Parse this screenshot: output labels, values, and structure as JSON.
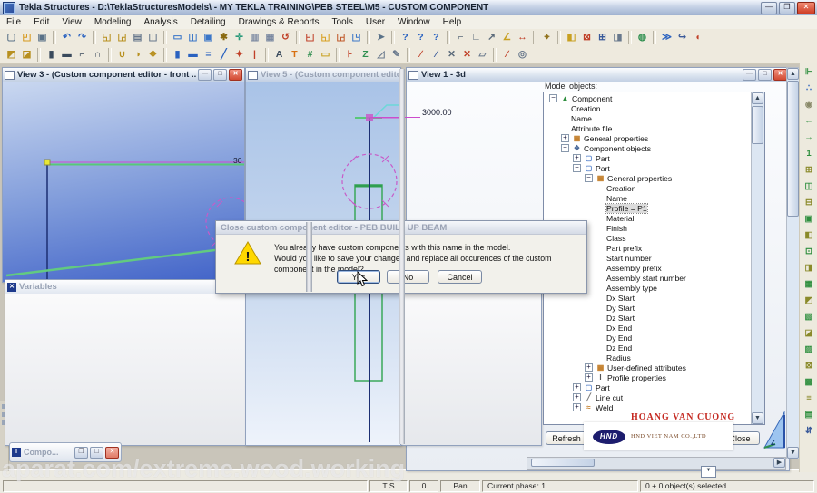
{
  "window": {
    "title": "Tekla Structures - D:\\TeklaStructuresModels\\ - MY TEKLA TRAINING\\PEB STEEL\\M5 - CUSTOM COMPONENT"
  },
  "menu": {
    "items": [
      "File",
      "Edit",
      "View",
      "Modeling",
      "Analysis",
      "Detailing",
      "Drawings & Reports",
      "Tools",
      "User",
      "Window",
      "Help"
    ]
  },
  "toolbar1": {
    "groups": [
      [
        "new",
        "open",
        "save"
      ],
      [
        "undo",
        "redo"
      ],
      [
        "fetch",
        "publish",
        "print",
        "catalog"
      ],
      [
        "fit-work-area",
        "fit-by-parts",
        "zoom-original",
        "zoom-in",
        "pan-view",
        "named-views",
        "tile-views",
        "redraw"
      ],
      [
        "view-properties",
        "display-settings",
        "representation",
        "view-list"
      ],
      [
        "fly"
      ],
      [
        "help",
        "context-help",
        "whats-this"
      ],
      [
        "measure-x",
        "measure-y",
        "measure-free",
        "measure-angle",
        "measure-bolt"
      ],
      [
        "create-point"
      ],
      [
        "phases",
        "delete-object",
        "numbering",
        "snapshot"
      ],
      [
        "hidden-lines"
      ],
      [
        "fast-forward",
        "export-model",
        "clash-check"
      ]
    ]
  },
  "toolbar2": {
    "groups": [
      [
        "auto-connection",
        "auto-defaults"
      ],
      [
        "create-column",
        "create-beam",
        "create-polybeam",
        "create-curved-beam"
      ],
      [
        "contour-plate",
        "twin-profile",
        "slab"
      ],
      [
        "ortho-column",
        "ortho-beam",
        "twin-beam",
        "brace",
        "bolt",
        "anchor-rod"
      ],
      [
        "auto-position",
        "text-tool",
        "grid-line",
        "plate-tool"
      ],
      [
        "pos-1",
        "pos-2",
        "pos-3",
        "pos-4"
      ],
      [
        "weld-tool",
        "weld-polygon",
        "cut-line",
        "cut-polygon",
        "fitting"
      ],
      [
        "weld-between",
        "circle-weld"
      ]
    ]
  },
  "right_toolbar": {
    "icons": [
      "define-component",
      "component-browser",
      "select-similar",
      "arrow-left",
      "arrow-right",
      "number-one",
      "end-plate",
      "column-splice",
      "base-plate",
      "stiffener",
      "haunch",
      "clip-angle",
      "two-sided-clip",
      "gusset",
      "tube-gusset",
      "wraparound-gusset",
      "bracing-connection",
      "purlin-connection",
      "seating-connection",
      "welded-gusset",
      "cage-ladder",
      "stairs",
      "updown"
    ]
  },
  "views": {
    "view3": {
      "title": "View 3 - (Custom component editor - front ...",
      "dim_label": "30"
    },
    "view5": {
      "title": "View 5 - (Custom component edito...",
      "dim_label": "3000.00"
    },
    "view1": {
      "title": "View 1 - 3d"
    }
  },
  "model_objects": {
    "label": "Model objects:",
    "refresh_label": "Refresh",
    "close_label": "Close",
    "tree": [
      {
        "label": "Component",
        "level": 0,
        "toggle": "-",
        "icon": "component"
      },
      {
        "label": "Creation",
        "level": 1
      },
      {
        "label": "Name",
        "level": 1
      },
      {
        "label": "Attribute file",
        "level": 1
      },
      {
        "label": "General properties",
        "level": 1,
        "toggle": "+",
        "icon": "grid"
      },
      {
        "label": "Component objects",
        "level": 1,
        "toggle": "-",
        "icon": "gear"
      },
      {
        "label": "Part",
        "level": 2,
        "toggle": "+",
        "icon": "part"
      },
      {
        "label": "Part",
        "level": 2,
        "toggle": "-",
        "icon": "part"
      },
      {
        "label": "General properties",
        "level": 3,
        "toggle": "-",
        "icon": "grid"
      },
      {
        "label": "Creation",
        "level": 4
      },
      {
        "label": "Name",
        "level": 4
      },
      {
        "label": "Profile = P1",
        "level": 4,
        "selected": true
      },
      {
        "label": "Material",
        "level": 4
      },
      {
        "label": "Finish",
        "level": 4
      },
      {
        "label": "Class",
        "level": 4
      },
      {
        "label": "Part prefix",
        "level": 4
      },
      {
        "label": "Start number",
        "level": 4
      },
      {
        "label": "Assembly prefix",
        "level": 4
      },
      {
        "label": "Assembly start number",
        "level": 4
      },
      {
        "label": "Assembly type",
        "level": 4
      },
      {
        "label": "Dx Start",
        "level": 4
      },
      {
        "label": "Dy Start",
        "level": 4
      },
      {
        "label": "Dz Start",
        "level": 4
      },
      {
        "label": "Dx End",
        "level": 4
      },
      {
        "label": "Dy End",
        "level": 4
      },
      {
        "label": "Dz End",
        "level": 4
      },
      {
        "label": "Radius",
        "level": 4
      },
      {
        "label": "User-defined attributes",
        "level": 3,
        "toggle": "+",
        "icon": "grid"
      },
      {
        "label": "Profile properties",
        "level": 3,
        "toggle": "+",
        "icon": "profile"
      },
      {
        "label": "Part",
        "level": 2,
        "toggle": "+",
        "icon": "part"
      },
      {
        "label": "Line cut",
        "level": 2,
        "toggle": "+",
        "icon": "linecut"
      },
      {
        "label": "Weld",
        "level": 2,
        "toggle": "+",
        "icon": "weld"
      }
    ]
  },
  "dialog": {
    "title": "Close custom component editor - PEB BUILT UP BEAM",
    "line1": "You already have custom components with this name in the model.",
    "line2": "Would you like to save your changes and replace all occurences of the custom component in the model?",
    "buttons": [
      "Yes",
      "No",
      "Cancel"
    ]
  },
  "variables_window": {
    "title": "Variables"
  },
  "compo_window": {
    "title": "Compo..."
  },
  "statusbar": {
    "ts": "T S",
    "count": "0",
    "mode": "Pan",
    "phase": "Current phase: 1",
    "selected": "0 + 0 object(s) selected"
  },
  "watermarks": {
    "bottom": "aparat.com/extreme.wood.working",
    "name": "HOANG VAN CUONG",
    "logo_text": "HND",
    "logo_caption": "HND VIET NAM CO.,LTD"
  },
  "colors": {
    "accent": "#2a62c0",
    "close_red": "#d24a32",
    "view_gradient_top": "#cad8f0",
    "view_gradient_bottom": "#4062c8",
    "selection": "#dcdcdc",
    "warning": "#ffd800",
    "dimension_magenta": "#cc4ccc",
    "geometry_green": "#58c878",
    "geometry_blue": "#1c2f73"
  }
}
